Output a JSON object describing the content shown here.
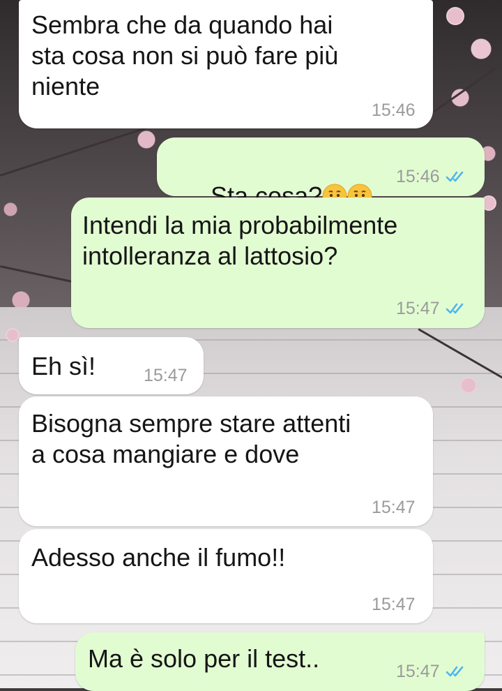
{
  "messages": [
    {
      "direction": "incoming",
      "text": "Sembra che da quando hai\nsta cosa non si può fare più\nniente",
      "time": "15:46"
    },
    {
      "direction": "outgoing",
      "text": "Sta cosa?",
      "emojis": [
        "sad-but-relieved-face",
        "sad-but-relieved-face"
      ],
      "time": "15:46",
      "status": "read"
    },
    {
      "direction": "outgoing",
      "text": "Intendi la mia probabilmente\nintolleranza al lattosio?",
      "time": "15:47",
      "status": "read"
    },
    {
      "direction": "incoming",
      "text": "Eh sì!",
      "time": "15:47"
    },
    {
      "direction": "incoming",
      "text": "Bisogna sempre stare attenti\na cosa mangiare e dove",
      "time": "15:47"
    },
    {
      "direction": "incoming",
      "text": "Adesso anche il fumo!!",
      "time": "15:47"
    },
    {
      "direction": "outgoing",
      "text": "Ma è solo per il test..",
      "time": "15:47",
      "status": "read"
    }
  ],
  "colors": {
    "incoming_bubble": "#ffffff",
    "outgoing_bubble": "#e2fcd2",
    "read_ticks": "#4fb6ec",
    "timestamp": "#9a9a9a"
  }
}
